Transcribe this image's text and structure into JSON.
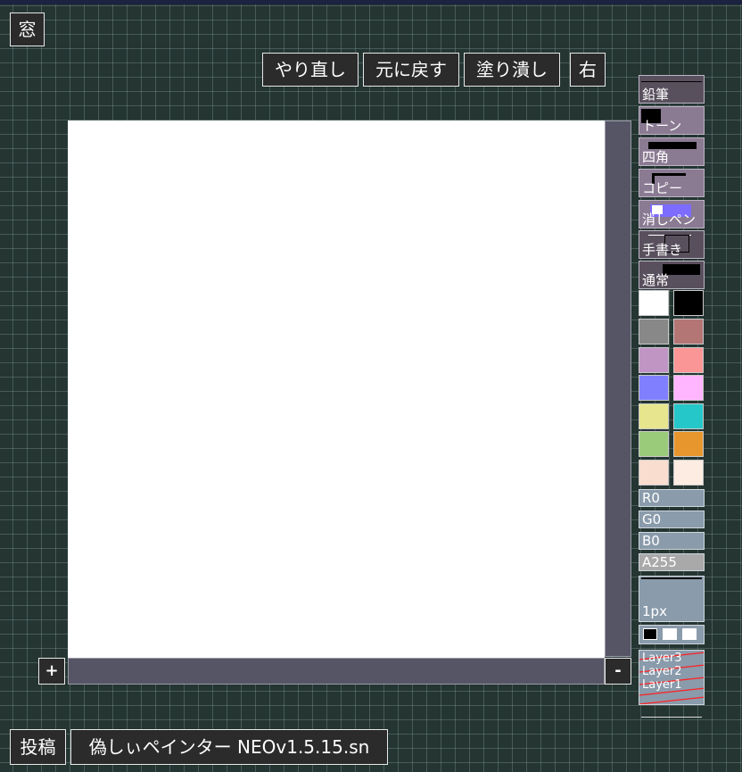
{
  "window_button": "窓",
  "toolbar": {
    "redo": "やり直し",
    "undo": "元に戻す",
    "fill": "塗り潰し",
    "side": "右"
  },
  "zoom": {
    "plus": "+",
    "minus": "-"
  },
  "tools": [
    {
      "label": "鉛筆"
    },
    {
      "label": "トーン"
    },
    {
      "label": "四角"
    },
    {
      "label": "コピー"
    },
    {
      "label": "消しペン"
    },
    {
      "label": "手書き"
    },
    {
      "label": "通常"
    }
  ],
  "palette": [
    [
      "#ffffff",
      "#000000"
    ],
    [
      "#888888",
      "#b47575"
    ],
    [
      "#c095c4",
      "#fa9696"
    ],
    [
      "#8080ff",
      "#ffb6ff"
    ],
    [
      "#e7e58d",
      "#25c7c9"
    ],
    [
      "#99cb7b",
      "#e7962d"
    ],
    [
      "#f9ddcf",
      "#fcece2"
    ]
  ],
  "color_sliders": {
    "r": "R0",
    "g": "G0",
    "b": "B0",
    "a": "A255"
  },
  "brush_size": "1px",
  "layers": [
    "Layer3",
    "Layer2",
    "Layer1"
  ],
  "bottom": {
    "post": "投稿",
    "app_name": "偽しぃペインター NEOv1.5.15.sn"
  }
}
